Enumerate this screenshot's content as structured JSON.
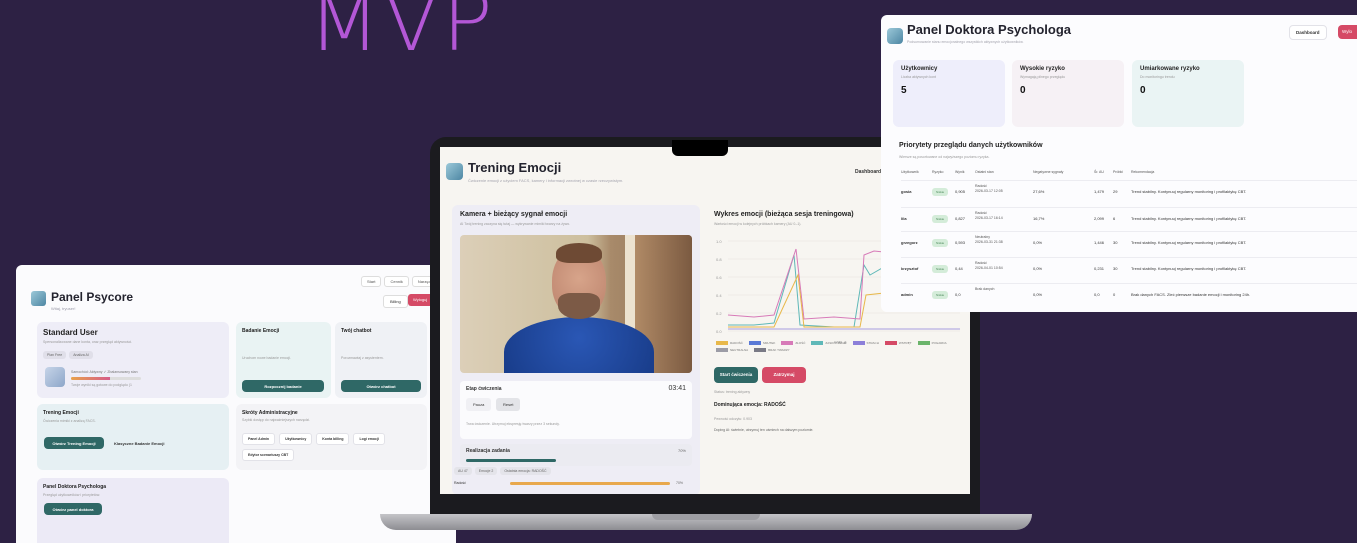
{
  "hero": {
    "text": "MVP"
  },
  "psycore": {
    "title": "Panel Psycore",
    "subtitle": "Witaj, tryuser!",
    "topnav": [
      "Start",
      "Cennik",
      "Narzędzia"
    ],
    "billing_label": "Billing",
    "logout_label": "Wyloguj",
    "standard_user": {
      "title": "Standard User",
      "description": "Spersonalizowane dane konta, oraz przegląd aktywności.",
      "pills": [
        "Plan Free",
        "Analiza AI"
      ],
      "status_line": "Samochód: Aktywny ✓  Zbalansowany stan",
      "hint_line": "Twoje wyniki są gotowe do podglądu (1"
    },
    "badanie": {
      "title": "Badanie Emocji",
      "description": "Uruchom nowe badanie emocji.",
      "button": "Rozpocznij badanie"
    },
    "chatbot": {
      "title": "Twój chatbot",
      "description": "Porozmawiaj z asystentem.",
      "button": "Otwórz chatbot"
    },
    "trening": {
      "title": "Trening Emocji",
      "description": "Ćwiczenia mimiki z analizą FACS.",
      "button": "Otwórz Trening Emocji",
      "link": "Klasyczne Badanie Emocji"
    },
    "admin": {
      "title": "Skróty Administracyjne",
      "description": "Szybki dostęp do najważniejszych narzędzi.",
      "links": [
        "Panel Admin",
        "Użytkownicy",
        "Konta billing",
        "Logi emocji",
        "Edytor scenariuszy CBT"
      ]
    },
    "doctor_panel": {
      "title": "Panel Doktora Psychologa",
      "description": "Przegląd użytkowników i priorytetów.",
      "button": "Otwórz panel doktora"
    }
  },
  "trening_emocji": {
    "title": "Trening Emocji",
    "subtitle": "Ćwiczenie emocji z użyciem FACS, kamery i informacji zwrotnej w czasie rzeczywistym.",
    "dashboard_label": "Dashboard",
    "camera": {
      "title": "Kamera + bieżący sygnał emocji",
      "description": "AI Twój trening zaczyna się tutaj — wykrywanie mimiki twarzy na żywo."
    },
    "session": {
      "title": "Etap ćwiczenia",
      "timer": "03:41",
      "pause_label": "Pauza",
      "reset_label": "Reset",
      "hint": "Trwa ćwiczenie. Utrzymuj ekspresję twarzy przez 3 sekundy."
    },
    "radiation": {
      "title": "Realizacja zadania",
      "value": "70%"
    },
    "chips": [
      "AU 47",
      "Emocje 2",
      "Ostatnia emocja: RADOŚĆ"
    ],
    "progress_row": {
      "label": "Radość",
      "value": "70%"
    },
    "chart": {
      "title": "Wykres emocji (bieżąca sesja treningowa)",
      "description": "Wartości emocji w kolejnych próbkach kamery (AU 0–1).",
      "y_ticks": [
        "1.0",
        "0.8",
        "0.6",
        "0.4",
        "0.2",
        "0.0"
      ],
      "xlabel": "czas_s",
      "series": [
        {
          "name": "RADOŚĆ",
          "color": "#e8b84a"
        },
        {
          "name": "SMUTEK",
          "color": "#5b7ad6"
        },
        {
          "name": "ZŁOŚĆ",
          "color": "#d77ab8"
        },
        {
          "name": "ZASKOCZENIE",
          "color": "#5fb8b8"
        },
        {
          "name": "STRACH",
          "color": "#8c7fd9"
        },
        {
          "name": "WSTRĘT",
          "color": "#d54a66"
        },
        {
          "name": "POGARDA",
          "color": "#6bb46b"
        },
        {
          "name": "NEUTRALNA",
          "color": "#9c9ca6"
        },
        {
          "name": "BRAK TWARZY",
          "color": "#7a7a86"
        }
      ]
    },
    "start_label": "Start ćwiczenia",
    "stop_label": "Zatrzymaj",
    "status": "Status: trening aktywny",
    "dominant": "Dominująca emocja: RADOŚĆ",
    "confidence": "Pewność odczytu: 0.903",
    "advice": "Doping AI: świetnie, utrzymuj ten uśmiech na dalszym poziomie."
  },
  "doktor": {
    "title": "Panel Doktora Psychologa",
    "subtitle": "Podsumowanie stanu emocjonalnego wszystkich aktywnych użytkowników.",
    "dashboard_label": "Dashboard",
    "logout_label": "Wylo",
    "stats": [
      {
        "label": "Użytkownicy",
        "sub": "Liczba aktywnych kont",
        "value": "5"
      },
      {
        "label": "Wysokie ryzyko",
        "sub": "Wymagają pilnego przeglądu",
        "value": "0"
      },
      {
        "label": "Umiarkowane ryzyko",
        "sub": "Do monitoringu trendu",
        "value": "0"
      }
    ],
    "priority_title": "Priorytety przeglądu danych użytkowników",
    "priority_desc": "Wiersze są posortowane od najwyższego poziomu ryzyka.",
    "columns": [
      "Użytkownik",
      "Ryzyko",
      "Wynik",
      "Ostatni stan",
      "Negatywne sygnały",
      "Śr. AU",
      "Próbki",
      "Rekomendacja"
    ],
    "rows": [
      {
        "user": "gosia",
        "risk": "Niskie",
        "score": "0,905",
        "state": "Radość",
        "date": "2026-03-17 12:05",
        "neg": "27,6%",
        "au": "1,479",
        "samples": "29",
        "rec": "Trend stabilny. Kontynuuj regularny monitoring i profilaktykę CBT."
      },
      {
        "user": "lila",
        "risk": "Niskie",
        "score": "0,827",
        "state": "Radość",
        "date": "2026-03-17 16:14",
        "neg": "16,7%",
        "au": "2,099",
        "samples": "6",
        "rec": "Trend stabilny. Kontynuuj regularny monitoring i profilaktykę CBT."
      },
      {
        "user": "grzegorz",
        "risk": "Niskie",
        "score": "0,593",
        "state": "Neutralny",
        "date": "2026-03-31 21:38",
        "neg": "0,0%",
        "au": "1,446",
        "samples": "30",
        "rec": "Trend stabilny. Kontynuuj regularny monitoring i profilaktykę CBT."
      },
      {
        "user": "krzysztof",
        "risk": "Niskie",
        "score": "0,44",
        "state": "Radość",
        "date": "2026-04-01 10:54",
        "neg": "0,0%",
        "au": "0,231",
        "samples": "30",
        "rec": "Trend stabilny. Kontynuuj regularny monitoring i profilaktykę CBT."
      },
      {
        "user": "admin",
        "risk": "Niskie",
        "score": "0,0",
        "state": "Brak danych",
        "date": "",
        "neg": "0,0%",
        "au": "0,0",
        "samples": "0",
        "rec": "Brak danych FACS. Zleć pierwsze badanie emocji i monitoring 24h."
      }
    ]
  }
}
